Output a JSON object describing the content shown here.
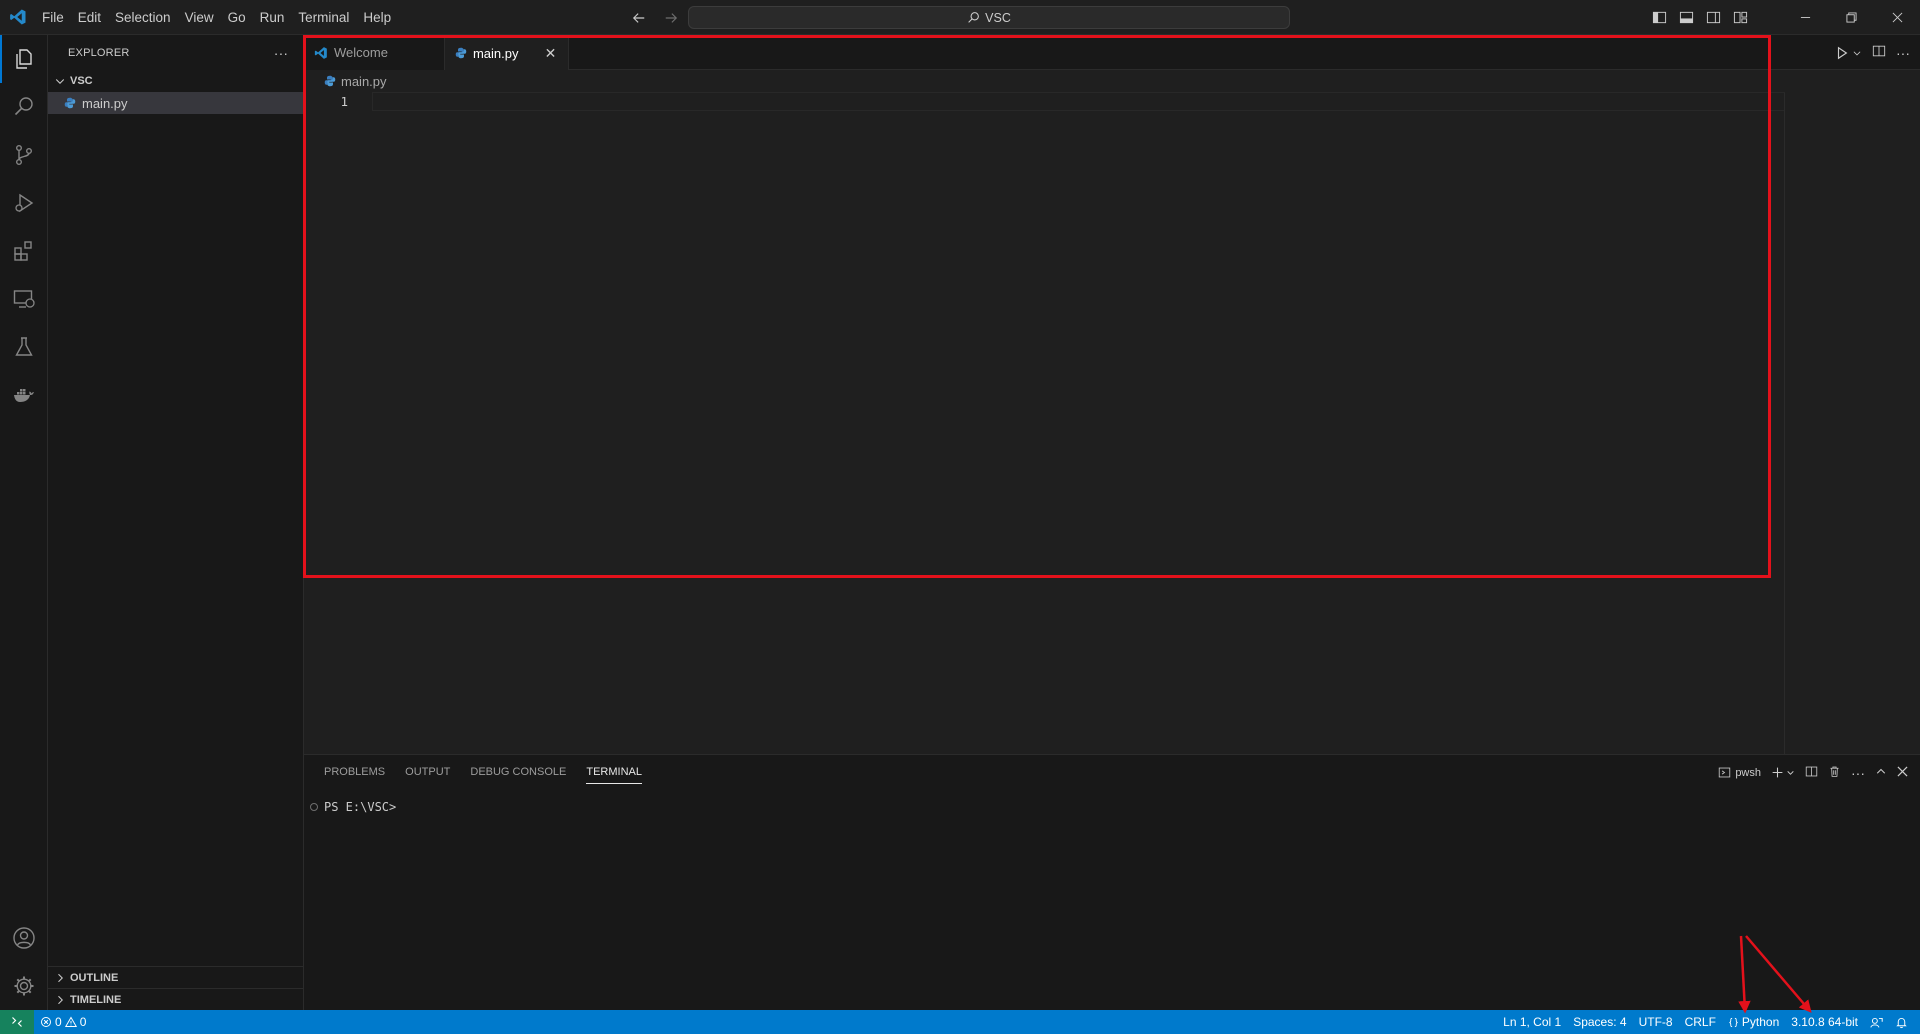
{
  "menu": [
    "File",
    "Edit",
    "Selection",
    "View",
    "Go",
    "Run",
    "Terminal",
    "Help"
  ],
  "command_center": {
    "label": "VSC"
  },
  "sidebar": {
    "title": "EXPLORER",
    "folder": "VSC",
    "files": [
      "main.py"
    ],
    "sections": [
      "OUTLINE",
      "TIMELINE"
    ]
  },
  "editor": {
    "tabs": [
      {
        "label": "Welcome",
        "active": false
      },
      {
        "label": "main.py",
        "active": true
      }
    ],
    "breadcrumb": "main.py",
    "line_numbers": [
      "1"
    ]
  },
  "panel": {
    "tabs": [
      "PROBLEMS",
      "OUTPUT",
      "DEBUG CONSOLE",
      "TERMINAL"
    ],
    "active_tab": "TERMINAL",
    "shell": "pwsh",
    "terminal_prompt": "PS E:\\VSC>"
  },
  "statusbar": {
    "errors": "0",
    "warnings": "0",
    "cursor": "Ln 1, Col 1",
    "spaces": "Spaces: 4",
    "encoding": "UTF-8",
    "eol": "CRLF",
    "language": "Python",
    "interpreter": "3.10.8 64-bit"
  },
  "colors": {
    "accent": "#0078d4",
    "statusbar": "#007acc",
    "annotation": "#e3111b"
  }
}
